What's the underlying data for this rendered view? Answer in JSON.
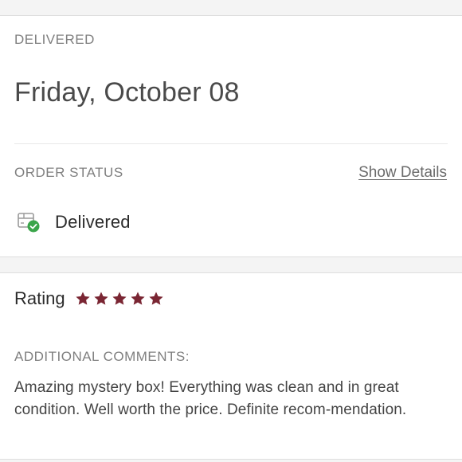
{
  "delivery": {
    "label": "DELIVERED",
    "date": "Friday, October 08"
  },
  "order_status": {
    "label": "ORDER STATUS",
    "show_details": "Show Details",
    "status": "Delivered",
    "status_icon": "delivered-box-check-icon"
  },
  "rating": {
    "label": "Rating",
    "stars": 5,
    "max_stars": 5,
    "star_color": "#7a2633"
  },
  "comments": {
    "label": "ADDITIONAL COMMENTS:",
    "text": "Amazing mystery box! Everything was clean and in great condition. Well worth the price. Definite recom-mendation."
  },
  "colors": {
    "accent_green": "#3aa54a",
    "star": "#7a2633",
    "muted_text": "#7f7f7f"
  }
}
